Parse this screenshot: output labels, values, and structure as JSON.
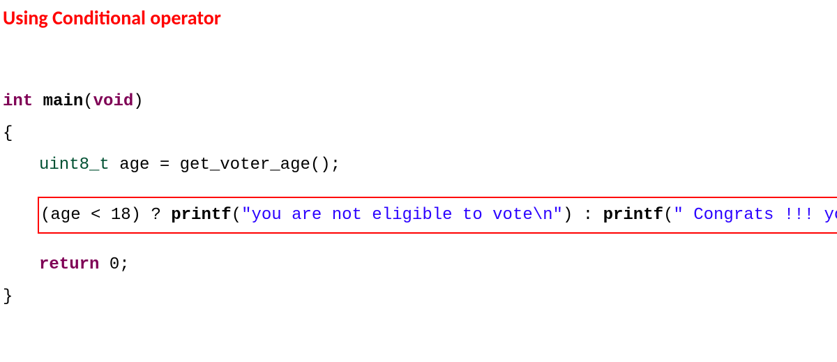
{
  "title": "Using Conditional operator",
  "code": {
    "line1": {
      "kw_int": "int",
      "fn_main": "main",
      "open_p": "(",
      "kw_void": "void",
      "close_p": ")"
    },
    "line2": "{",
    "line3": {
      "type": "uint8_t",
      "var": " age ",
      "eq": "=",
      "call": " get_voter_age();"
    },
    "line4": {
      "open_p": "(age ",
      "lt": "<",
      "num": " 18) ",
      "q": "?",
      "sp1": " ",
      "printf1": "printf",
      "p1o": "(",
      "str1": "\"you are not eligible to vote\\n\"",
      "p1c": ") ",
      "colon": ":",
      "sp2": " ",
      "printf2": "printf",
      "p2o": "(",
      "str2": "\" Congrats !!! you can vote\\n\"",
      "p2c": ");"
    },
    "line5": {
      "kw_return": "return",
      "val": " 0;"
    },
    "line6": "}"
  }
}
